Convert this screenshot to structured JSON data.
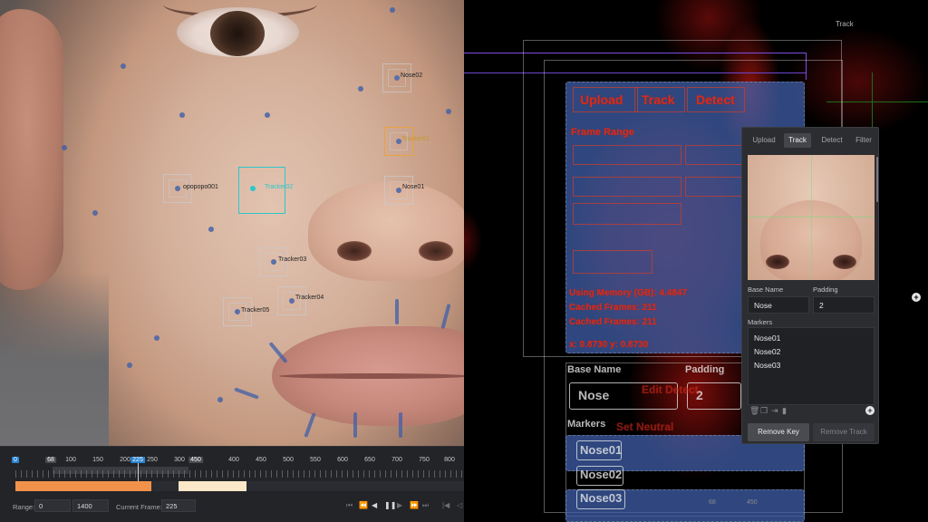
{
  "trackers": {
    "nose02": "Nose02",
    "tracker01": "Tracker01",
    "popopopo001": "opopopo001",
    "tracker02": "Tracker02",
    "nose01": "Nose01",
    "tracker03": "Tracker03",
    "tracker04": "Tracker04",
    "tracker05": "Tracker05"
  },
  "timeline": {
    "ticks": [
      "0",
      "68",
      "100",
      "150",
      "200",
      "225",
      "250",
      "300",
      "450",
      "400",
      "450",
      "500",
      "550",
      "600",
      "650",
      "700",
      "750",
      "800"
    ],
    "range_label": "Range:",
    "range_start": "0",
    "range_end": "1400",
    "current_frame_label": "Current Frame:",
    "current_frame": "225",
    "range_fraction": 0.3,
    "keyframe_fraction": 0.15
  },
  "overlay": {
    "track_label": "Track",
    "ghost_upload": "Upload",
    "ghost_track": "Track",
    "ghost_detect": "Detect",
    "ghost_frame_range": "Frame Range",
    "ghost_base_name": "Base Name",
    "ghost_padding": "Padding",
    "ghost_nose": "Nose",
    "ghost_two": "2",
    "ghost_edit_detect": "Edit Detect",
    "ghost_markers": "Markers",
    "ghost_set_neutral": "Set Neutral",
    "ghost_nose01": "Nose01",
    "ghost_nose02": "Nose02",
    "ghost_nose03": "Nose03",
    "ghost_mem1": "Using Memory (GB): 4.4847",
    "ghost_mem2": "Cached Frames: 211",
    "ghost_coords": "x: 0.8730 y: 0.8730",
    "bottom_68": "68",
    "bottom_450": "450"
  },
  "panel": {
    "tabs": [
      "Upload",
      "Track",
      "Detect",
      "Filter"
    ],
    "active_tab": "Track",
    "base_name_label": "Base Name",
    "base_name_value": "Nose",
    "padding_label": "Padding",
    "padding_value": "2",
    "markers_label": "Markers",
    "markers": [
      "Nose01",
      "Nose02",
      "Nose03"
    ],
    "remove_key": "Remove Key",
    "remove_track": "Remove Track"
  },
  "colors": {
    "accent_blue": "#2a84d2",
    "range_orange": "#f2924a",
    "selected_tracker": "#2fc6c9",
    "panel_bg": "#2c2d31"
  }
}
